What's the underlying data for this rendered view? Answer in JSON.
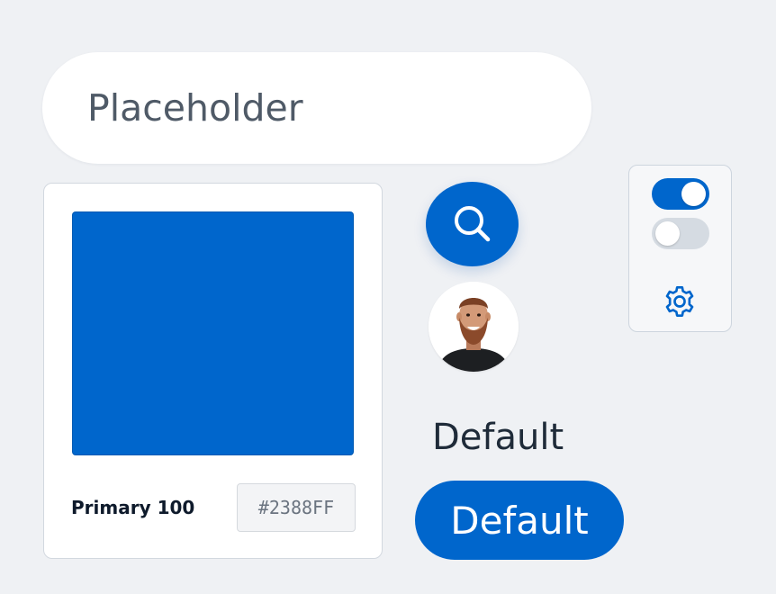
{
  "search": {
    "placeholder": "Placeholder",
    "value": ""
  },
  "color_card": {
    "swatch_color": "#0066CC",
    "label": "Primary 100",
    "hex_value": "#2388FF"
  },
  "search_button": {
    "icon": "search-icon",
    "color": "#0066CC"
  },
  "avatar": {
    "icon": "user-avatar-photo"
  },
  "text_sample": {
    "label": "Default"
  },
  "primary_button": {
    "label": "Default",
    "color": "#0066CC"
  },
  "settings_panel": {
    "toggles": [
      {
        "state": "on",
        "color": "#0066CC"
      },
      {
        "state": "off",
        "color": "#D5DBE2"
      }
    ],
    "gear_icon": "gear-icon",
    "accent": "#0066CC"
  }
}
